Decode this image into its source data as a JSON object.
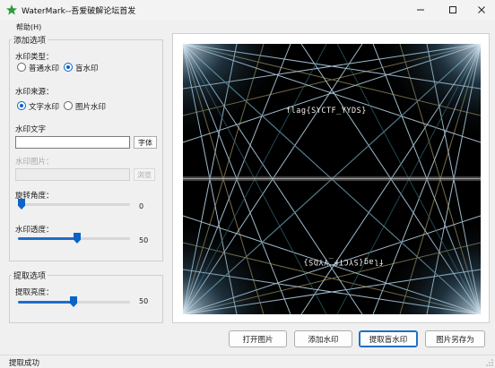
{
  "window": {
    "title": "WaterMark--吾爱破解论坛首发",
    "app_icon": "star-icon",
    "controls": [
      "minimize-icon",
      "maximize-icon",
      "close-icon"
    ]
  },
  "menu": {
    "help": "帮助(H)"
  },
  "add_group": {
    "title": "添加选项",
    "type_label": "水印类型：",
    "type_options": [
      {
        "label": "普通水印",
        "checked": false
      },
      {
        "label": "盲水印",
        "checked": true
      }
    ],
    "source_label": "水印来源：",
    "source_options": [
      {
        "label": "文字水印",
        "checked": true
      },
      {
        "label": "图片水印",
        "checked": false
      }
    ],
    "text_label": "水印文字",
    "text_value": "",
    "font_button": "字体",
    "image_label": "水印图片：",
    "image_value": "",
    "browse_button": "浏览",
    "rotation_label": "旋转角度：",
    "rotation_value": 0,
    "opacity_label": "水印透度：",
    "opacity_value": 50
  },
  "extract_group": {
    "title": "提取选项",
    "brightness_label": "提取亮度：",
    "brightness_value": 50
  },
  "preview": {
    "flag_text": "flag{SYCTF_YYDS}",
    "flag_text_mirrored": "flag{SYCTF_YYDS}"
  },
  "actions": {
    "open": "打开图片",
    "add": "添加水印",
    "extract": "提取盲水印",
    "save_as": "图片另存为"
  },
  "status": {
    "text": "提取成功"
  },
  "colors": {
    "accent": "#0a64c8",
    "preview_bg": "#000000",
    "window_bg": "#f0f0f0"
  }
}
